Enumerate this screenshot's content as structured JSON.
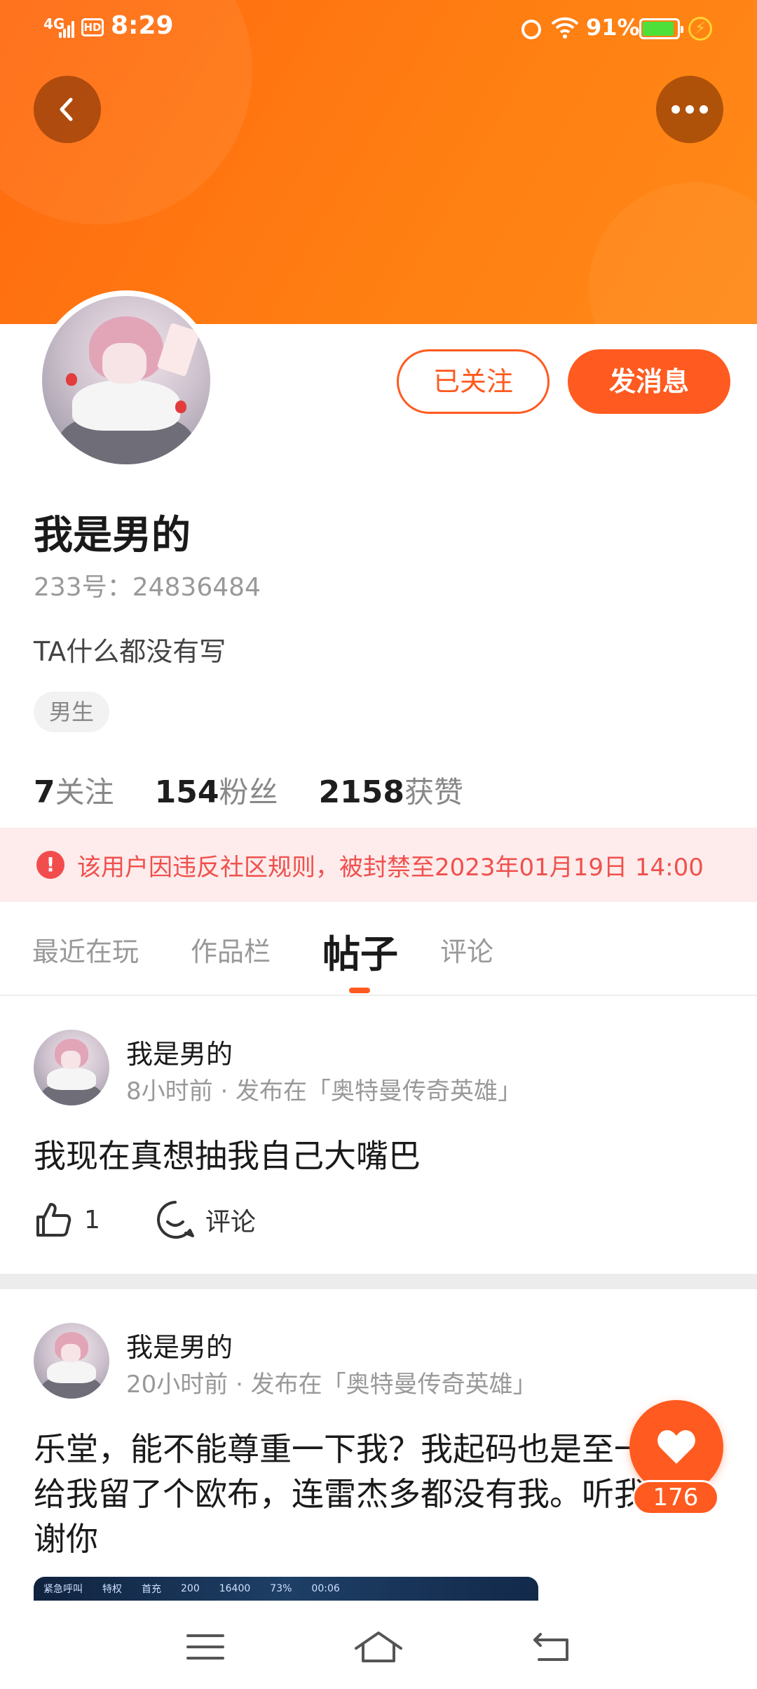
{
  "status_bar": {
    "network": "4G",
    "hd": "HD",
    "time": "8:29",
    "battery_percent": "91%",
    "battery_level": 0.91
  },
  "header": {
    "back_icon": "chevron-left-icon",
    "more_icon": "more-dots-icon",
    "follow_status": "已关注",
    "message_button": "发消息"
  },
  "profile": {
    "username": "我是男的",
    "id_label": "233号：24836484",
    "bio": "TA什么都没有写",
    "gender_tag": "男生",
    "stats": [
      {
        "value": "7",
        "label": "关注"
      },
      {
        "value": "154",
        "label": "粉丝"
      },
      {
        "value": "2158",
        "label": "获赞"
      }
    ]
  },
  "ban_notice": {
    "icon": "alert-icon",
    "icon_glyph": "!",
    "text": "该用户因违反社区规则，被封禁至2023年01月19日 14:00"
  },
  "tabs": [
    {
      "label": "最近在玩",
      "active": false
    },
    {
      "label": "作品栏",
      "active": false
    },
    {
      "label": "帖子",
      "active": true
    },
    {
      "label": "评论",
      "active": false
    }
  ],
  "posts": [
    {
      "author": "我是男的",
      "meta": "8小时前 · 发布在「奥特曼传奇英雄」",
      "body": "我现在真想抽我自己大嘴巴",
      "likes": "1",
      "comment_label": "评论"
    },
    {
      "author": "我是男的",
      "meta": "20小时前 · 发布在「奥特曼传奇英雄」",
      "body": "乐堂，能不能尊重一下我？我起码也是至一，就给我留了个欧布，连雷杰多都没有我。听我说谢谢你"
    }
  ],
  "game_screenshot_text": {
    "a": "紧急呼叫",
    "b": "特权",
    "c": "首充",
    "d": "200",
    "e": "16400",
    "f": "73%",
    "g": "00:06"
  },
  "fab": {
    "icon": "heart-icon",
    "count": "176"
  },
  "nav": [
    "menu-icon",
    "home-icon",
    "back-icon"
  ],
  "colors": {
    "accent": "#ff5a1f",
    "header": "#ff7a12",
    "ban_bg": "#fdeceb",
    "ban_text": "#f0504e"
  }
}
